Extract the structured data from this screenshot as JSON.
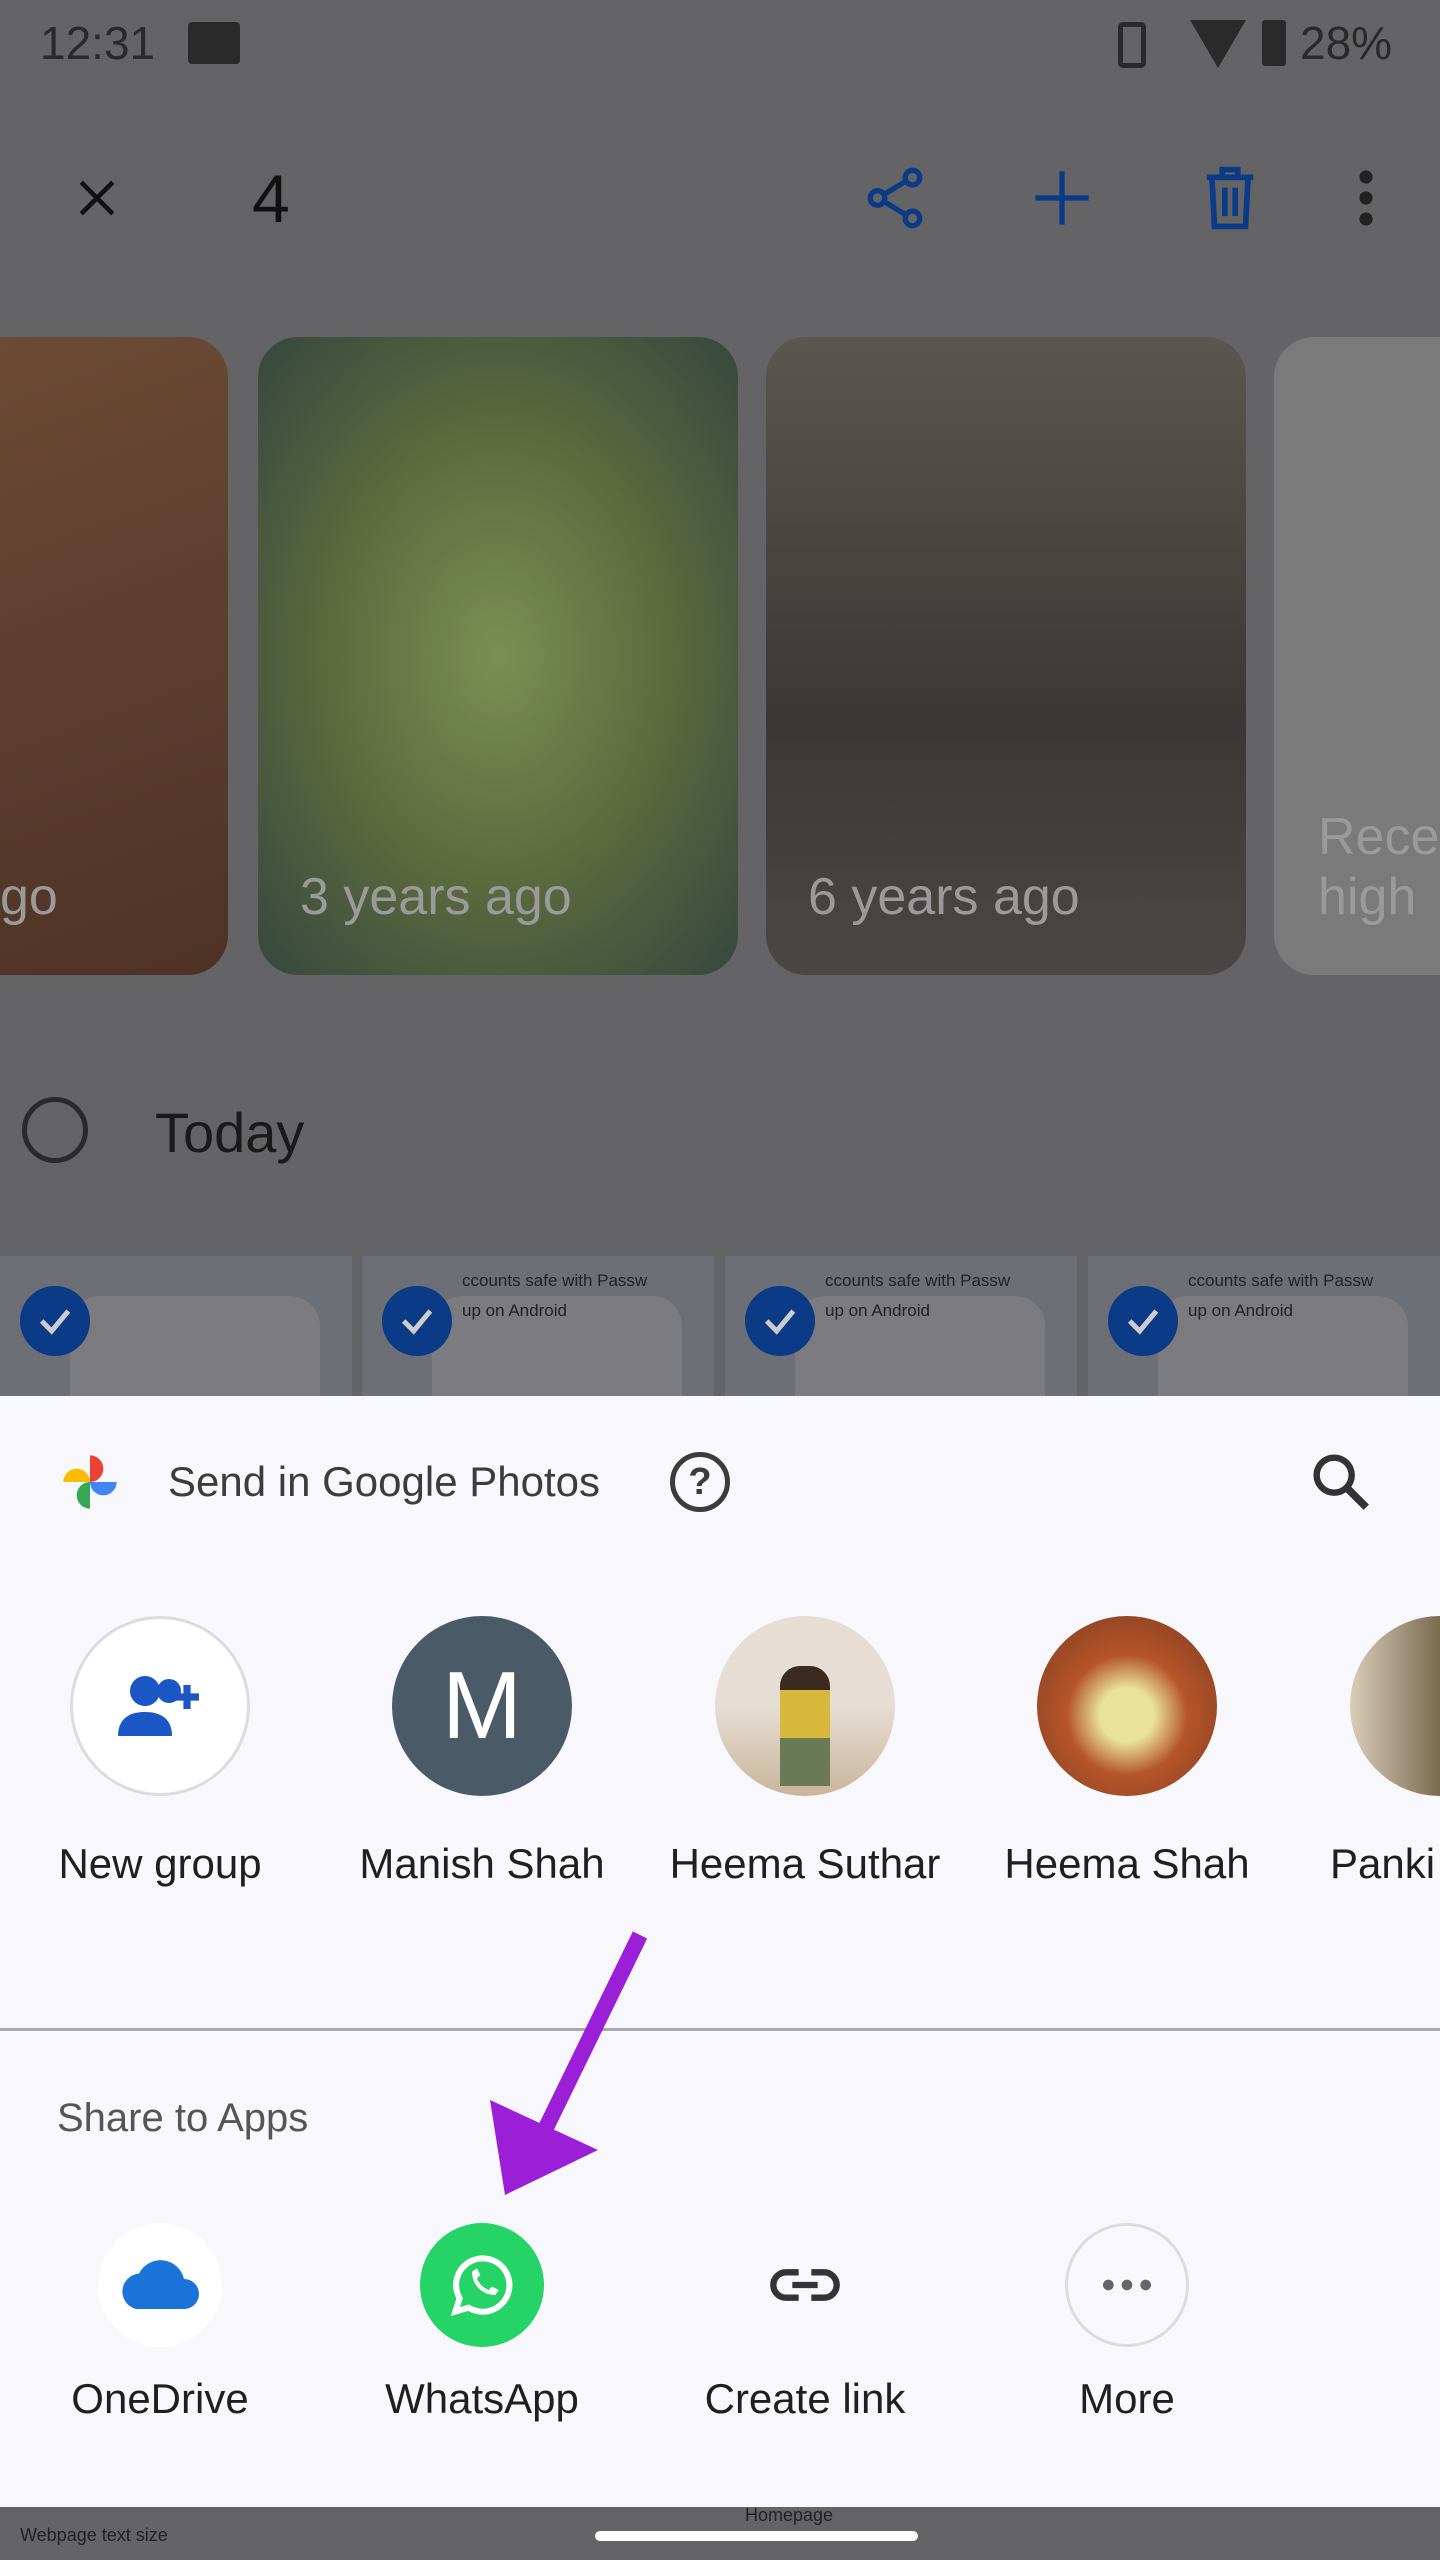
{
  "status_bar": {
    "time": "12:31",
    "battery": "28%"
  },
  "top_bar": {
    "selected_count": "4"
  },
  "memories": [
    {
      "label": "go"
    },
    {
      "label": "3 years ago"
    },
    {
      "label": "6 years ago"
    },
    {
      "label": "Rece\nhigh"
    }
  ],
  "section": {
    "title": "Today"
  },
  "thumbs": [
    {
      "line1": "",
      "line2": ""
    },
    {
      "line1": "ccounts safe with Passw",
      "line2": "up on Android"
    },
    {
      "line1": "ccounts safe with Passw",
      "line2": "up on Android"
    },
    {
      "line1": "ccounts safe with Passw",
      "line2": "up on Android"
    }
  ],
  "sheet": {
    "title": "Send in Google Photos",
    "contacts": [
      {
        "label": "New group"
      },
      {
        "label": "Manish Shah",
        "initial": "M"
      },
      {
        "label": "Heema Suthar"
      },
      {
        "label": "Heema Shah"
      },
      {
        "label": "Panki"
      }
    ],
    "share_title": "Share to Apps",
    "apps": [
      {
        "label": "OneDrive"
      },
      {
        "label": "WhatsApp"
      },
      {
        "label": "Create link"
      },
      {
        "label": "More"
      }
    ]
  },
  "background_text": {
    "bottom_left": "Webpage text size",
    "bottom_mid": "Homepage"
  },
  "colors": {
    "accent": "#0b3a86",
    "annotation_arrow": "#9b1fd6",
    "whatsapp": "#25d366"
  }
}
